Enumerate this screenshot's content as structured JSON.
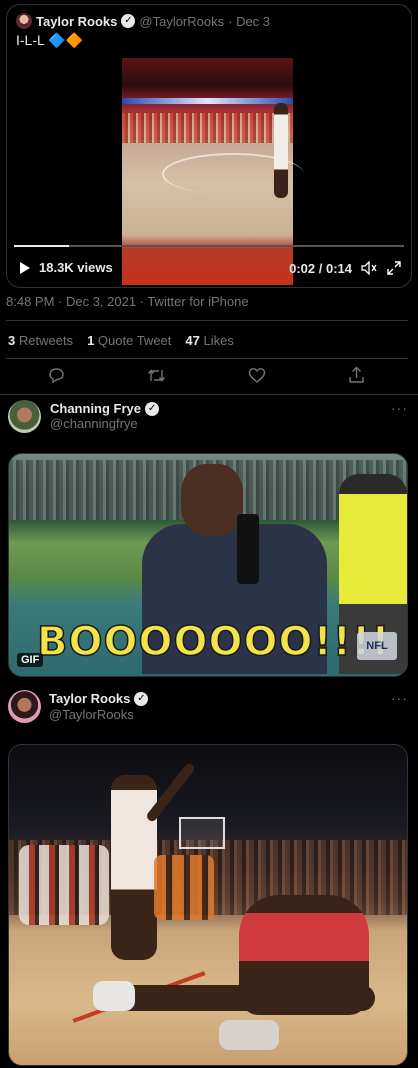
{
  "quoted_tweet": {
    "author_name": "Taylor Rooks",
    "author_handle": "@TaylorRooks",
    "date": "· Dec 3",
    "text": "I-L-L 🔷🔶",
    "video": {
      "views": "18.3K views",
      "time": "0:02 / 0:14",
      "progress": 0.14
    }
  },
  "main_tweet": {
    "timestamp": "8:48 PM · Dec 3, 2021 · Twitter for iPhone",
    "stats": {
      "retweets_count": "3",
      "retweets_label": "Retweets",
      "quotes_count": "1",
      "quotes_label": "Quote Tweet",
      "likes_count": "47",
      "likes_label": "Likes"
    }
  },
  "reply_1": {
    "author_name": "Channing Frye",
    "author_handle": "@channingfrye",
    "more": "···",
    "gif_badge": "GIF",
    "gif_caption": "BOOOOOOO!!!!",
    "gif_logo": "NFL"
  },
  "reply_2": {
    "author_name": "Taylor Rooks",
    "author_handle": "@TaylorRooks",
    "more": "···"
  },
  "colors": {
    "background": "#000000",
    "text": "#e7e9ea",
    "muted": "#71767b",
    "divider": "#2f3336",
    "caption_yellow": "#f3e34a"
  }
}
